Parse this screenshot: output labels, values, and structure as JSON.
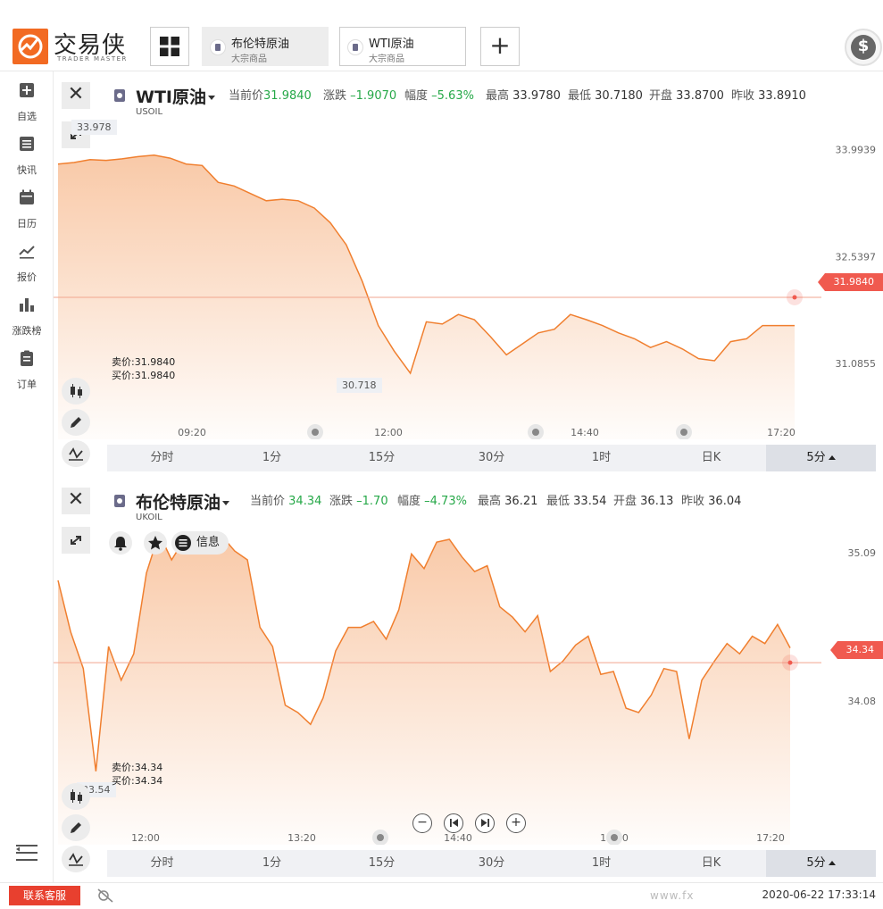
{
  "brand": {
    "name": "交易侠",
    "sub": "TRADER MASTER"
  },
  "tabs": [
    {
      "title": "布伦特原油",
      "sub": "大宗商品",
      "active": true
    },
    {
      "title": "WTI原油",
      "sub": "大宗商品",
      "active": false
    }
  ],
  "sidebar": {
    "items": [
      {
        "label": "自选",
        "icon": "plus-square-icon"
      },
      {
        "label": "快讯",
        "icon": "list-icon"
      },
      {
        "label": "日历",
        "icon": "calendar-icon"
      },
      {
        "label": "报价",
        "icon": "trend-icon"
      },
      {
        "label": "涨跌榜",
        "icon": "bar-chart-icon"
      },
      {
        "label": "订单",
        "icon": "clipboard-icon"
      }
    ]
  },
  "panel1": {
    "name": "WTI原油",
    "code": "USOIL",
    "quote": {
      "current_label": "当前价",
      "current": "31.9840",
      "change_label": "涨跌",
      "change": "–1.9070",
      "range_label": "幅度",
      "range": "–5.63%",
      "high_label": "最高",
      "high": "33.9780",
      "low_label": "最低",
      "low": "30.7180",
      "open_label": "开盘",
      "open": "33.8700",
      "prev_label": "昨收",
      "prev": "33.8910"
    },
    "sell": "卖价:31.9840",
    "buy": "买价:31.9840",
    "max_marker": "33.978",
    "min_marker": "30.718",
    "price_tag": "31.9840",
    "periods": [
      "分时",
      "1分",
      "15分",
      "30分",
      "1时",
      "日K",
      "5分"
    ]
  },
  "panel2": {
    "name": "布伦特原油",
    "code": "UKOIL",
    "quote": {
      "current_label": "当前价",
      "current": "34.34",
      "change_label": "涨跌",
      "change": "–1.70",
      "range_label": "幅度",
      "range": "–4.73%",
      "high_label": "最高",
      "high": "36.21",
      "low_label": "最低",
      "low": "33.54",
      "open_label": "开盘",
      "open": "36.13",
      "prev_label": "昨收",
      "prev": "36.04"
    },
    "sell": "卖价:34.34",
    "buy": "买价:34.34",
    "min_marker": "33.54",
    "price_tag": "34.34",
    "info_label": "信息",
    "periods": [
      "分时",
      "1分",
      "15分",
      "30分",
      "1时",
      "日K",
      "5分"
    ]
  },
  "chart_data": [
    {
      "type": "area",
      "series_of": "WTI原油",
      "x_ticks": [
        "09:20",
        "12:00",
        "14:40",
        "17:20"
      ],
      "y_ticks": [
        "33.9939",
        "32.5397",
        "31.0855"
      ],
      "y_tick_values": [
        33.9939,
        32.5397,
        31.0855
      ],
      "ylim": [
        30.05,
        34.55
      ],
      "values": [
        33.8,
        33.82,
        33.86,
        33.85,
        33.87,
        33.9,
        33.92,
        33.88,
        33.8,
        33.78,
        33.55,
        33.5,
        33.4,
        33.3,
        33.32,
        33.3,
        33.2,
        33.0,
        32.7,
        32.2,
        31.6,
        31.25,
        30.95,
        31.65,
        31.62,
        31.75,
        31.68,
        31.45,
        31.2,
        31.35,
        31.5,
        31.55,
        31.75,
        31.68,
        31.6,
        31.5,
        31.42,
        31.3,
        31.38,
        31.28,
        31.15,
        31.12,
        31.38,
        31.42,
        31.6,
        31.6,
        31.6
      ],
      "current": 31.984,
      "color": "#f07f2f"
    },
    {
      "type": "area",
      "series_of": "布伦特原油",
      "x_ticks": [
        "12:00",
        "13:20",
        "14:40",
        "16:00",
        "17:20"
      ],
      "y_ticks": [
        "35.09",
        "34.08"
      ],
      "y_tick_values": [
        35.09,
        34.08
      ],
      "ylim": [
        33.1,
        35.35
      ],
      "values": [
        34.9,
        34.55,
        34.3,
        33.6,
        34.45,
        34.22,
        34.4,
        34.95,
        35.22,
        35.04,
        35.18,
        35.12,
        35.16,
        35.2,
        35.1,
        35.04,
        34.58,
        34.45,
        34.05,
        34.0,
        33.92,
        34.1,
        34.42,
        34.58,
        34.58,
        34.62,
        34.5,
        34.7,
        35.08,
        34.98,
        35.16,
        35.18,
        35.06,
        34.96,
        35.0,
        34.72,
        34.65,
        34.55,
        34.66,
        34.28,
        34.35,
        34.46,
        34.52,
        34.26,
        34.28,
        34.03,
        34.0,
        34.12,
        34.3,
        34.28,
        33.82,
        34.22,
        34.35,
        34.47,
        34.4,
        34.52,
        34.47,
        34.6,
        34.44
      ],
      "current": 34.34,
      "color": "#f07f2f"
    }
  ],
  "bottom": {
    "cs_label": "联系客服",
    "timestamp": "2020-06-22 17:33:14",
    "watermark": "www.fx"
  },
  "colors": {
    "accent": "#f26a22",
    "line": "#f07f2f",
    "up": "#26a848",
    "tag": "#f05a4f"
  }
}
